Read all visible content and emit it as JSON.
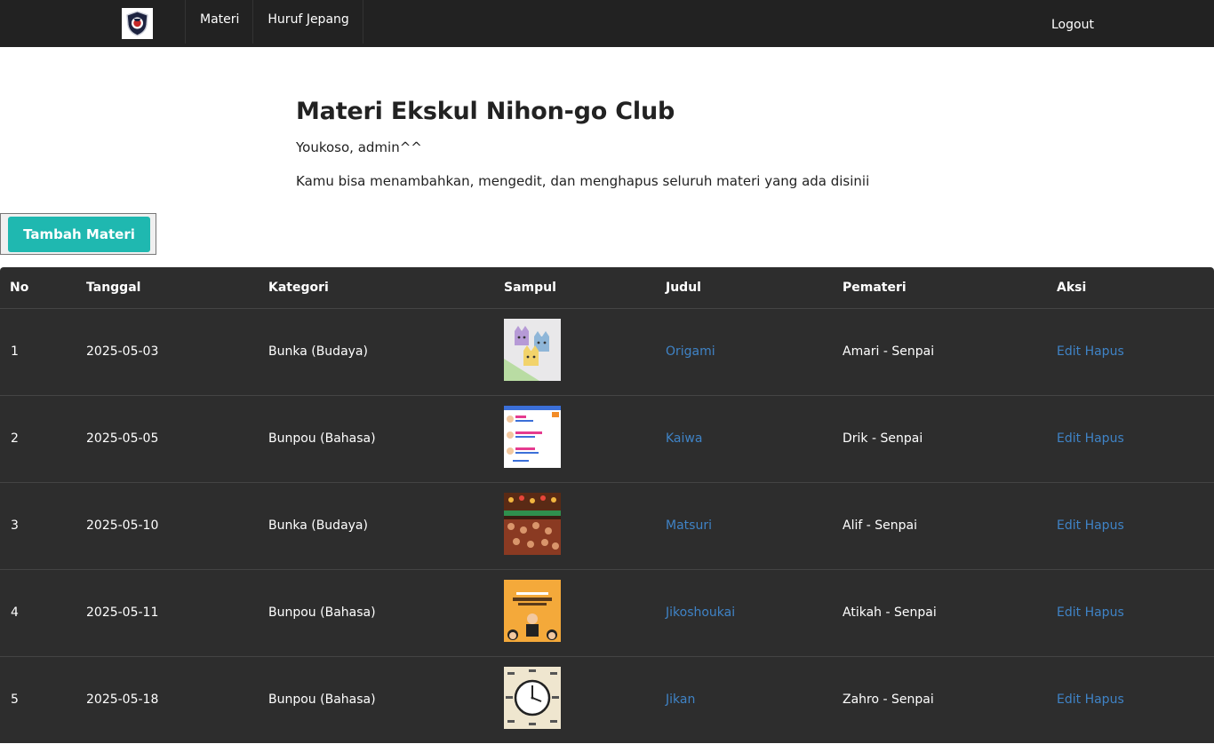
{
  "nav": {
    "links": [
      "Materi",
      "Huruf Jepang"
    ],
    "logout": "Logout"
  },
  "header": {
    "title": "Materi Ekskul Nihon-go Club",
    "welcome": "Youkoso, admin^^",
    "description": "Kamu bisa menambahkan, mengedit, dan menghapus seluruh materi yang ada disinii"
  },
  "add_button": "Tambah Materi",
  "table": {
    "columns": [
      "No",
      "Tanggal",
      "Kategori",
      "Sampul",
      "Judul",
      "Pemateri",
      "Aksi"
    ],
    "rows": [
      {
        "no": "1",
        "tanggal": "2025-05-03",
        "kategori": "Bunka (Budaya)",
        "judul": "Origami",
        "pemateri": "Amari - Senpai",
        "edit": "Edit",
        "hapus": "Hapus"
      },
      {
        "no": "2",
        "tanggal": "2025-05-05",
        "kategori": "Bunpou (Bahasa)",
        "judul": "Kaiwa",
        "pemateri": "Drik - Senpai",
        "edit": "Edit",
        "hapus": "Hapus"
      },
      {
        "no": "3",
        "tanggal": "2025-05-10",
        "kategori": "Bunka (Budaya)",
        "judul": "Matsuri",
        "pemateri": "Alif - Senpai",
        "edit": "Edit",
        "hapus": "Hapus"
      },
      {
        "no": "4",
        "tanggal": "2025-05-11",
        "kategori": "Bunpou (Bahasa)",
        "judul": "Jikoshoukai",
        "pemateri": "Atikah - Senpai",
        "edit": "Edit",
        "hapus": "Hapus"
      },
      {
        "no": "5",
        "tanggal": "2025-05-18",
        "kategori": "Bunpou (Bahasa)",
        "judul": "Jikan",
        "pemateri": "Zahro - Senpai",
        "edit": "Edit",
        "hapus": "Hapus"
      }
    ]
  },
  "colors": {
    "navbar": "#222222",
    "table_bg": "#2d2d2d",
    "accent": "#1fb8b0",
    "link": "#3f83c6"
  }
}
